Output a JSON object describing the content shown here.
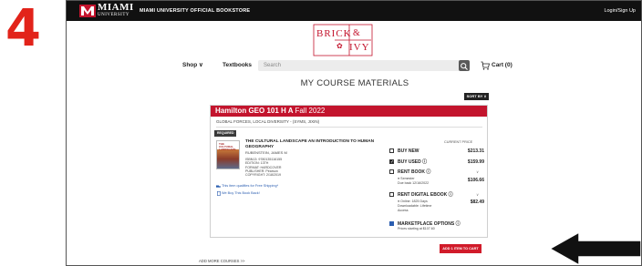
{
  "step_number": "4",
  "topbar": {
    "logo_word": "MIAMI",
    "logo_sub": "UNIVERSITY",
    "store_name": "MIAMI UNIVERSITY OFFICIAL BOOKSTORE",
    "login_label": "Login/Sign Up"
  },
  "brand": {
    "brick": "BRICK",
    "amp": "&",
    "ivy": "IVY"
  },
  "nav": {
    "shop_label": "Shop ∨",
    "textbooks_label": "Textbooks",
    "search_placeholder": "Search",
    "cart_label": "Cart (0)"
  },
  "page_title": "MY COURSE MATERIALS",
  "sort_label": "SORT BY ∨",
  "course": {
    "header": "Hamilton GEO 101 H A",
    "term": "Fall 2022",
    "subtitle": "GLOBAL FORCES, LOCAL DIVERSITY - (SYMS, JIXIN)",
    "required_tag": "REQUIRED"
  },
  "book": {
    "cover_text": "THE CULTURAL LANDSCAPE",
    "title": "THE CULTURAL LANDSCAPE AN INTRODUCTION TO HUMAN GEOGRAPHY",
    "author": "RUBENSTEIN, JAMES M",
    "meta": [
      "ISBN13: 9780135116155",
      "EDITION: 13TH",
      "FORMAT: HARDCOVER",
      "PUBLISHER: Pearson",
      "COPYRIGHT: 2/18/2019"
    ],
    "free_shipping_link": "This item qualifies for Free Shipping*",
    "buyback_link": "We Buy This Book Back!"
  },
  "options": {
    "current_price_label": "CURRENT PRICE",
    "buy_new": {
      "label": "BUY NEW",
      "price": "$213.31",
      "checked": false
    },
    "buy_used": {
      "label": "BUY USED",
      "price": "$159.99",
      "checked": true
    },
    "rent_book": {
      "label": "RENT BOOK",
      "caret": "∨",
      "sub1": "Semester",
      "sub2": "Due back 12/16/2022",
      "price": "$106.66"
    },
    "rent_ebook": {
      "label": "RENT DIGITAL EBOOK",
      "caret": "∨",
      "sub1": "Online: 1825 Days",
      "sub2": "Downloadable: Lifetime",
      "sub3": "Access",
      "price": "$82.49"
    },
    "marketplace": {
      "label": "MARKETPLACE OPTIONS",
      "sub1": "Prices starting at $107.60"
    }
  },
  "add_to_cart_label": "ADD 1 ITEM TO CART",
  "add_more_courses": "ADD MORE COURSES >>",
  "colors": {
    "brand_red": "#c3142d",
    "step_red": "#e2231a",
    "topbar": "#111111"
  }
}
